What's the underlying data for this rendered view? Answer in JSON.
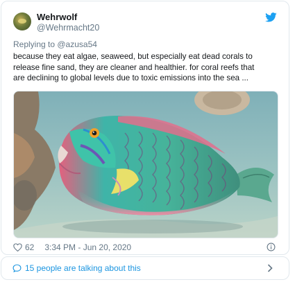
{
  "author": {
    "display_name": "Wehrwolf",
    "handle": "@Wehrmacht20",
    "avatar_icon": "avatar-image"
  },
  "reply": {
    "prefix": "Replying to ",
    "mention": "@azusa54"
  },
  "tweet": {
    "line1": "because they eat algae, seaweed, but especially eat dead corals to",
    "line2": "release fine sand, they are cleaner and healthier.  for coral reefs that",
    "line3": "are declining to global levels due to toxic emissions into the sea ..."
  },
  "media": {
    "description_icon": "parrotfish-photo"
  },
  "meta": {
    "likes": "62",
    "timestamp": "3:34 PM - Jun 20, 2020"
  },
  "conversation": {
    "label": "15 people are talking about this"
  },
  "colors": {
    "twitter_blue": "#1da1f2",
    "link_blue": "#1b95e0",
    "secondary_text": "#657786",
    "border": "#e1e8ed"
  }
}
